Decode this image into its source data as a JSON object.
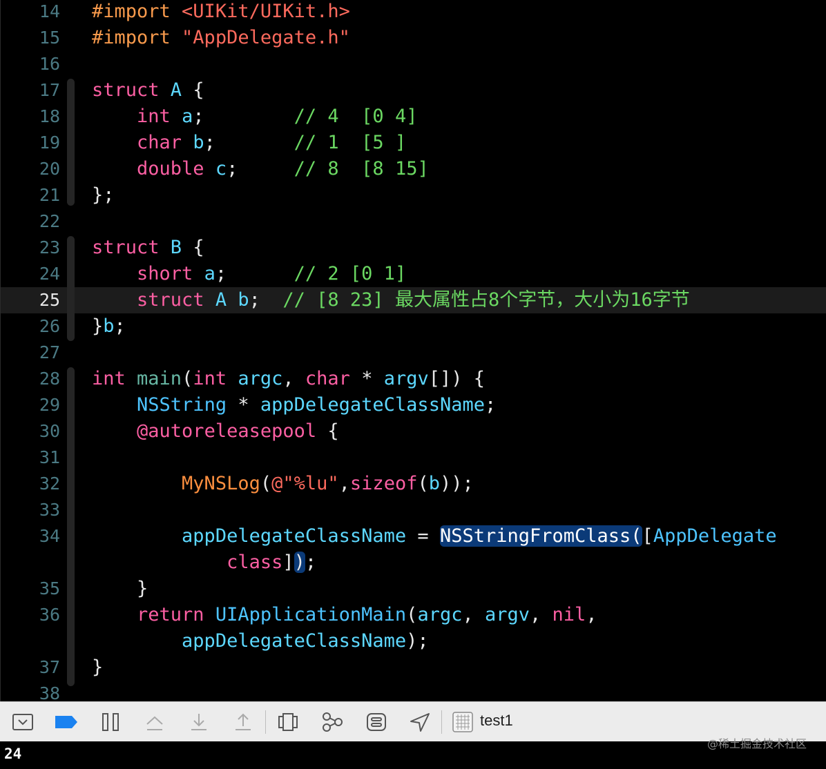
{
  "editor": {
    "lines": [
      {
        "n": "14",
        "t": [
          [
            "t-pre",
            "#import "
          ],
          [
            "t-str",
            "<UIKit/UIKit.h>"
          ]
        ]
      },
      {
        "n": "15",
        "t": [
          [
            "t-pre",
            "#import "
          ],
          [
            "t-str",
            "\"AppDelegate.h\""
          ]
        ]
      },
      {
        "n": "16",
        "t": []
      },
      {
        "n": "17",
        "t": [
          [
            "t-kw",
            "struct "
          ],
          [
            "t-id",
            "A "
          ],
          [
            "t-p",
            "{"
          ]
        ]
      },
      {
        "n": "18",
        "t": [
          [
            "t-p",
            "    "
          ],
          [
            "t-kw",
            "int "
          ],
          [
            "t-id",
            "a"
          ],
          [
            "t-p",
            ";        "
          ],
          [
            "t-cm",
            "// 4  [0 4]"
          ]
        ]
      },
      {
        "n": "19",
        "t": [
          [
            "t-p",
            "    "
          ],
          [
            "t-kw",
            "char "
          ],
          [
            "t-id",
            "b"
          ],
          [
            "t-p",
            ";       "
          ],
          [
            "t-cm",
            "// 1  [5 ]"
          ]
        ]
      },
      {
        "n": "20",
        "t": [
          [
            "t-p",
            "    "
          ],
          [
            "t-kw",
            "double "
          ],
          [
            "t-id",
            "c"
          ],
          [
            "t-p",
            ";     "
          ],
          [
            "t-cm",
            "// 8  [8 15]"
          ]
        ]
      },
      {
        "n": "21",
        "t": [
          [
            "t-p",
            "};"
          ]
        ]
      },
      {
        "n": "22",
        "t": []
      },
      {
        "n": "23",
        "t": [
          [
            "t-kw",
            "struct "
          ],
          [
            "t-id",
            "B "
          ],
          [
            "t-p",
            "{"
          ]
        ]
      },
      {
        "n": "24",
        "t": [
          [
            "t-p",
            "    "
          ],
          [
            "t-kw",
            "short "
          ],
          [
            "t-id",
            "a"
          ],
          [
            "t-p",
            ";      "
          ],
          [
            "t-cm",
            "// 2 [0 1]"
          ]
        ]
      },
      {
        "n": "25",
        "current": true,
        "t": [
          [
            "t-p",
            "    "
          ],
          [
            "t-kw",
            "struct "
          ],
          [
            "t-id",
            "A b"
          ],
          [
            "t-p",
            ";  "
          ],
          [
            "t-cm",
            "// [8 23] 最大属性占8个字节，大小为16字节"
          ]
        ]
      },
      {
        "n": "26",
        "t": [
          [
            "t-p",
            "}"
          ],
          [
            "t-id",
            "b"
          ],
          [
            "t-p",
            ";"
          ]
        ]
      },
      {
        "n": "27",
        "t": []
      },
      {
        "n": "28",
        "t": [
          [
            "t-kw",
            "int "
          ],
          [
            "t-fn",
            "main"
          ],
          [
            "t-p",
            "("
          ],
          [
            "t-kw",
            "int "
          ],
          [
            "t-id",
            "argc"
          ],
          [
            "t-p",
            ", "
          ],
          [
            "t-kw",
            "char "
          ],
          [
            "t-p",
            "* "
          ],
          [
            "t-id",
            "argv"
          ],
          [
            "t-p",
            "[]) {"
          ]
        ]
      },
      {
        "n": "29",
        "t": [
          [
            "t-p",
            "    "
          ],
          [
            "t-cls",
            "NSString "
          ],
          [
            "t-p",
            "* "
          ],
          [
            "t-id",
            "appDelegateClassName"
          ],
          [
            "t-p",
            ";"
          ]
        ]
      },
      {
        "n": "30",
        "t": [
          [
            "t-p",
            "    "
          ],
          [
            "t-kw",
            "@autoreleasepool "
          ],
          [
            "t-p",
            "{"
          ]
        ]
      },
      {
        "n": "31",
        "t": []
      },
      {
        "n": "32",
        "t": [
          [
            "t-p",
            "        "
          ],
          [
            "t-mac",
            "MyNSLog"
          ],
          [
            "t-p",
            "("
          ],
          [
            "t-str",
            "@\"%lu\""
          ],
          [
            "t-p",
            ","
          ],
          [
            "t-kw",
            "sizeof"
          ],
          [
            "t-p",
            "("
          ],
          [
            "t-id",
            "b"
          ],
          [
            "t-p",
            "));"
          ]
        ]
      },
      {
        "n": "33",
        "t": []
      },
      {
        "n": "34",
        "t": [
          [
            "t-p",
            "        "
          ],
          [
            "t-id",
            "appDelegateClassName "
          ],
          [
            "t-p",
            "= "
          ],
          [
            "t-fnh hl1",
            "NSStringFromClass("
          ],
          [
            "t-p",
            "["
          ],
          [
            "t-cls",
            "AppDelegate"
          ]
        ]
      },
      {
        "n": "",
        "t": [
          [
            "t-p",
            "            "
          ],
          [
            "t-kw",
            "class"
          ],
          [
            "t-p",
            "]"
          ],
          [
            "t-p hl2",
            ")"
          ],
          [
            "t-p",
            ";"
          ]
        ]
      },
      {
        "n": "35",
        "t": [
          [
            "t-p",
            "    }"
          ]
        ]
      },
      {
        "n": "36",
        "t": [
          [
            "t-p",
            "    "
          ],
          [
            "t-kw",
            "return "
          ],
          [
            "t-cls",
            "UIApplicationMain"
          ],
          [
            "t-p",
            "("
          ],
          [
            "t-id",
            "argc"
          ],
          [
            "t-p",
            ", "
          ],
          [
            "t-id",
            "argv"
          ],
          [
            "t-p",
            ", "
          ],
          [
            "t-kw",
            "nil"
          ],
          [
            "t-p",
            ","
          ]
        ]
      },
      {
        "n": "",
        "t": [
          [
            "t-p",
            "        "
          ],
          [
            "t-id",
            "appDelegateClassName"
          ],
          [
            "t-p",
            ");"
          ]
        ]
      },
      {
        "n": "37",
        "t": [
          [
            "t-p",
            "}"
          ]
        ]
      },
      {
        "n": "38",
        "t": []
      }
    ]
  },
  "toolbar": {
    "target_name": "test1",
    "icons": [
      "hide-debug-area-icon",
      "breakpoints-toggle-icon",
      "pause-icon",
      "step-over-icon",
      "step-into-icon",
      "step-out-icon",
      "view-debugger-icon",
      "memory-graph-icon",
      "environment-overrides-icon",
      "location-icon",
      "scheme-target-icon"
    ]
  },
  "console": {
    "output": "24"
  },
  "watermark": "@稀土掘金技术社区",
  "colors": {
    "background": "#000000",
    "keyword": "#fc5fa3",
    "identifier": "#5dd8ff",
    "comment": "#6bd862",
    "string": "#fc6a5d",
    "preprocessor": "#f89a4c",
    "selection": "#0b3a78",
    "breakpoint": "#1a82f0"
  }
}
